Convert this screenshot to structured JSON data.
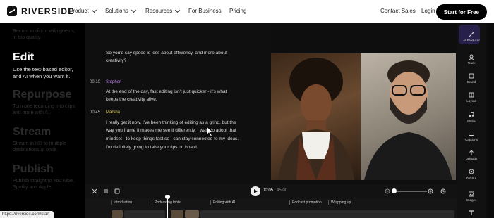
{
  "nav": {
    "brand": "RIVERSIDE",
    "menu": [
      {
        "label": "Product"
      },
      {
        "label": "Solutions"
      },
      {
        "label": "Resources"
      }
    ],
    "for_business": "For Business",
    "pricing": "Pricing",
    "contact_sales": "Contact Sales",
    "login": "Login",
    "cta": "Start for Free"
  },
  "left_panel": {
    "top_faded": "Record audio or with guests, in top quality.",
    "active_heading": "Edit",
    "active_desc": "Use the text-based editor, and AI when you want it.",
    "sections": [
      {
        "heading": "Repurpose",
        "desc": "Turn one recording into clips and more with AI."
      },
      {
        "heading": "Stream",
        "desc": "Stream in HD to multiple destinations at once."
      },
      {
        "heading": "Publish",
        "desc": "Publish straight to YouTube, Spotify and Apple."
      }
    ]
  },
  "transcript": {
    "intro_line1": "So you'd say speed is less about efficiency, and more about",
    "intro_line2": "creativity?",
    "entries": [
      {
        "timestamp": "00:10",
        "speaker": "Stephen",
        "speaker_color": "#c38cf2",
        "lines": [
          "At the end of the day, fast editing isn't just quicker - it's what",
          "keeps the creativity alive."
        ]
      },
      {
        "timestamp": "00:45",
        "speaker": "Marsha",
        "speaker_color": "#e6d66c",
        "lines": [
          "I really get it now. I've been thinking of editing as a grind, but the",
          "way you frame it makes me see it differently. I want to adopt that",
          "mindset - to keep things fast so I can stay connected to my ideas.",
          "I'm definitely going to take your tips on board."
        ]
      }
    ]
  },
  "tools": [
    {
      "label": "AI Producer",
      "icon": "wand-icon"
    },
    {
      "label": "Track",
      "icon": "track-icon"
    },
    {
      "label": "Brand",
      "icon": "brand-icon"
    },
    {
      "label": "Layout",
      "icon": "layout-icon"
    },
    {
      "label": "Music",
      "icon": "music-icon"
    },
    {
      "label": "Captions",
      "icon": "captions-icon"
    },
    {
      "label": "Uploads",
      "icon": "upload-icon"
    },
    {
      "label": "Record",
      "icon": "record-icon"
    },
    {
      "label": "Images",
      "icon": "image-icon"
    },
    {
      "label": "Text",
      "icon": "text-icon"
    }
  ],
  "playback": {
    "current": "00:05",
    "total": "/ 45:00"
  },
  "timeline": {
    "chapters": [
      "Introduction",
      "Podcasting tools",
      "Editing with AI",
      "Podcast promotion",
      "Wrapping up"
    ]
  },
  "status_url": "https://riverside.com/start",
  "colors": {
    "accent_purple": "#6b5cf0",
    "panel_bg": "#0e0e0e"
  }
}
